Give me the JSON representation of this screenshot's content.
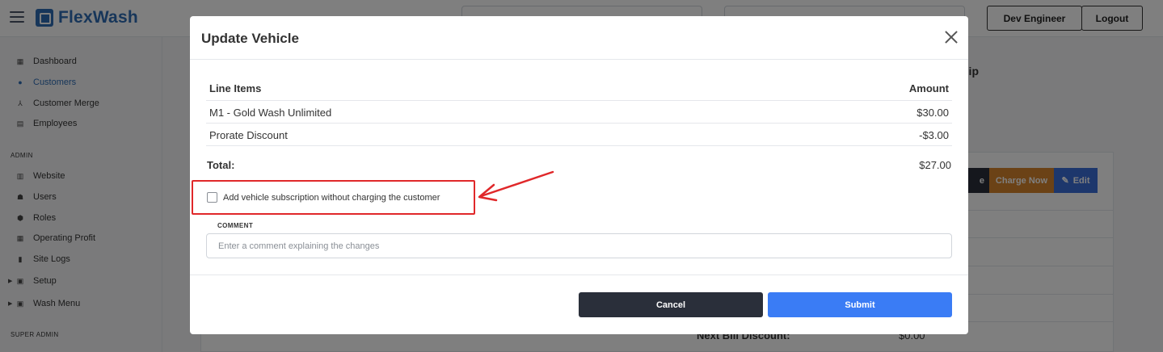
{
  "app": {
    "brand": "FlexWash",
    "user_button": "Dev Engineer",
    "logout_button": "Logout"
  },
  "sidebar": {
    "items": [
      {
        "label": "Dashboard",
        "icon": "dashboard-icon"
      },
      {
        "label": "Customers",
        "icon": "customers-icon",
        "active": true
      },
      {
        "label": "Customer Merge",
        "icon": "merge-icon"
      },
      {
        "label": "Employees",
        "icon": "employees-icon"
      }
    ],
    "admin_section": "ADMIN",
    "admin_items": [
      {
        "label": "Website",
        "icon": "website-icon"
      },
      {
        "label": "Users",
        "icon": "users-icon"
      },
      {
        "label": "Roles",
        "icon": "roles-icon"
      },
      {
        "label": "Operating Profit",
        "icon": "calculator-icon"
      },
      {
        "label": "Site Logs",
        "icon": "logs-icon"
      },
      {
        "label": "Setup",
        "icon": "caret-right-icon"
      },
      {
        "label": "Wash Menu",
        "icon": "caret-right-icon"
      }
    ],
    "super_admin_section": "SUPER ADMIN"
  },
  "background": {
    "heading_fragment": "hip",
    "action_fragment": "e",
    "charge_now": "Charge Now",
    "edit": "Edit",
    "next_bill_discount_label": "Next Bill Discount:",
    "next_bill_discount_value": "$0.00"
  },
  "modal": {
    "title": "Update Vehicle",
    "table": {
      "header_name": "Line Items",
      "header_amount": "Amount",
      "rows": [
        {
          "name": "M1 - Gold Wash Unlimited",
          "amount": "$30.00"
        },
        {
          "name": "Prorate Discount",
          "amount": "-$3.00"
        }
      ]
    },
    "total_label": "Total:",
    "total_value": "$27.00",
    "checkbox_label": "Add vehicle subscription without charging the customer",
    "checkbox_checked": false,
    "comment_label": "COMMENT",
    "comment_placeholder": "Enter a comment explaining the changes",
    "cancel_button": "Cancel",
    "submit_button": "Submit"
  },
  "colors": {
    "brand": "#2f6db5",
    "highlight": "#e0282a",
    "submit": "#3a7cf5",
    "cancel": "#2a2f3a",
    "charge_now": "#d6842c"
  }
}
